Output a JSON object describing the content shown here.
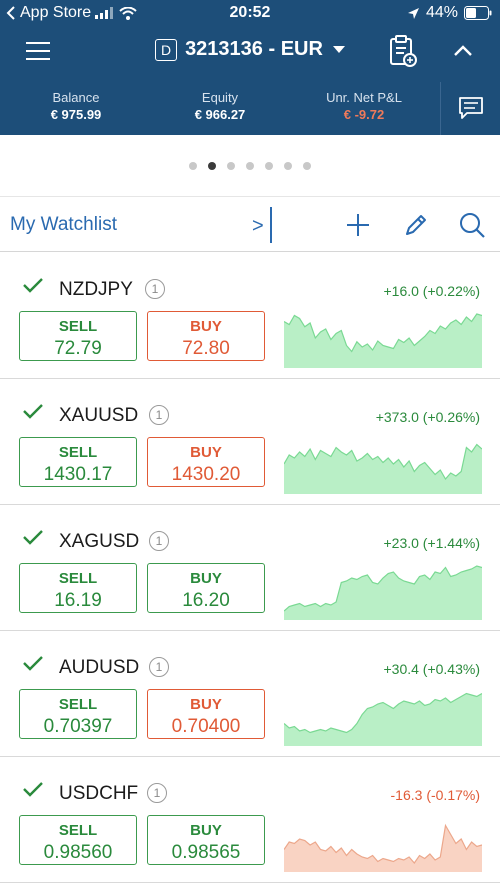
{
  "status_bar": {
    "carrier": "App Store",
    "time": "20:52",
    "battery": "44%"
  },
  "nav": {
    "account_badge": "D",
    "account": "3213136 - EUR"
  },
  "summary": {
    "balance_label": "Balance",
    "balance_value": "€ 975.99",
    "equity_label": "Equity",
    "equity_value": "€ 966.27",
    "pnl_label": "Unr. Net P&L",
    "pnl_value": "€ -9.72"
  },
  "pager": {
    "count": 7,
    "active_index": 1
  },
  "watchlist": {
    "title": "My Watchlist",
    "chevron": ">"
  },
  "colors": {
    "header": "#1d4e79",
    "up": "#2a8a3c",
    "down": "#e05a36",
    "up_fill": "#b9efc6",
    "down_fill": "#f9d3c3"
  },
  "instruments": [
    {
      "symbol": "NZDJPY",
      "badge": "1",
      "change": "+16.0 (+0.22%)",
      "direction": "up",
      "sell_label": "SELL",
      "sell_price": "72.79",
      "buy_label": "BUY",
      "buy_price": "72.80",
      "buy_color": "red",
      "spark": [
        62,
        58,
        70,
        66,
        55,
        60,
        40,
        48,
        52,
        38,
        46,
        50,
        30,
        22,
        35,
        28,
        32,
        24,
        36,
        30,
        28,
        26,
        38,
        34,
        40,
        30,
        36,
        42,
        50,
        46,
        56,
        52,
        60,
        64,
        58,
        68,
        62,
        72,
        70
      ]
    },
    {
      "symbol": "XAUUSD",
      "badge": "1",
      "change": "+373.0 (+0.26%)",
      "direction": "up",
      "sell_label": "SELL",
      "sell_price": "1430.17",
      "buy_label": "BUY",
      "buy_price": "1430.20",
      "buy_color": "red",
      "spark": [
        40,
        52,
        48,
        56,
        50,
        60,
        46,
        58,
        54,
        50,
        62,
        56,
        52,
        58,
        44,
        48,
        54,
        46,
        50,
        42,
        48,
        40,
        46,
        36,
        44,
        30,
        38,
        42,
        34,
        26,
        32,
        20,
        28,
        24,
        30,
        62,
        56,
        66,
        60
      ]
    },
    {
      "symbol": "XAGUSD",
      "badge": "1",
      "change": "+23.0 (+1.44%)",
      "direction": "up",
      "sell_label": "SELL",
      "sell_price": "16.19",
      "buy_label": "BUY",
      "buy_price": "16.20",
      "buy_color": "green",
      "spark": [
        12,
        18,
        20,
        22,
        18,
        20,
        22,
        18,
        22,
        20,
        24,
        50,
        52,
        56,
        54,
        58,
        60,
        50,
        48,
        56,
        62,
        64,
        56,
        52,
        50,
        48,
        58,
        60,
        54,
        64,
        62,
        70,
        58,
        60,
        64,
        66,
        68,
        72,
        70
      ]
    },
    {
      "symbol": "AUDUSD",
      "badge": "1",
      "change": "+30.4 (+0.43%)",
      "direction": "up",
      "sell_label": "SELL",
      "sell_price": "0.70397",
      "buy_label": "BUY",
      "buy_price": "0.70400",
      "buy_color": "red",
      "spark": [
        30,
        24,
        26,
        20,
        22,
        18,
        20,
        22,
        20,
        24,
        22,
        20,
        18,
        22,
        30,
        42,
        50,
        52,
        56,
        58,
        54,
        50,
        56,
        60,
        58,
        56,
        60,
        54,
        56,
        62,
        60,
        64,
        58,
        62,
        66,
        70,
        68,
        66,
        70
      ]
    },
    {
      "symbol": "USDCHF",
      "badge": "1",
      "change": "-16.3 (-0.17%)",
      "direction": "down",
      "sell_label": "SELL",
      "sell_price": "0.98560",
      "buy_label": "BUY",
      "buy_price": "0.98565",
      "buy_color": "green",
      "spark": [
        30,
        40,
        38,
        44,
        42,
        36,
        40,
        30,
        28,
        34,
        26,
        32,
        22,
        30,
        24,
        20,
        18,
        22,
        14,
        18,
        16,
        14,
        18,
        16,
        20,
        12,
        22,
        18,
        24,
        16,
        20,
        62,
        50,
        38,
        44,
        30,
        40,
        34,
        36
      ]
    }
  ]
}
